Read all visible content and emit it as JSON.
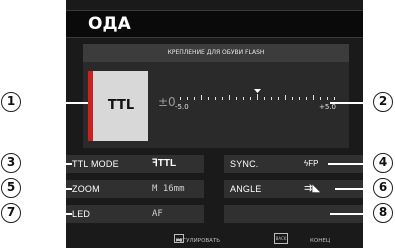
{
  "title": "ОДА",
  "subheader": "КРЕПЛЕНИЕ ДЛЯ ОБУВИ FLASH",
  "mode": "TTL",
  "ev": {
    "value": "±0",
    "scale_min": "-5.0",
    "scale_max": "+5.0"
  },
  "rows": [
    {
      "label": "TTL MODE",
      "value": "ꟻTTL"
    },
    {
      "label": "SYNC.",
      "value": "ϟFP"
    },
    {
      "label": "ZOOM",
      "value": "M 16mm"
    },
    {
      "label": "ANGLE",
      "value": "⇉◣"
    },
    {
      "label": "LED",
      "value": "AF"
    },
    {
      "label": "",
      "value": ""
    }
  ],
  "footer": {
    "adjust_label": "РЕГУЛИРОВАТЬ",
    "end_label": "КОНЕЦ",
    "back_key": "BACK"
  },
  "callouts": [
    "1",
    "2",
    "3",
    "4",
    "5",
    "6",
    "7",
    "8"
  ]
}
